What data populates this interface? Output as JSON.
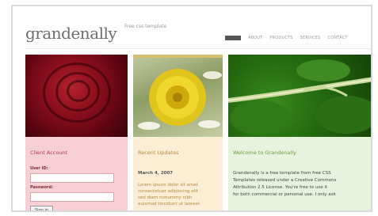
{
  "site": {
    "logo": "grandenally",
    "tagline": "Free css template"
  },
  "nav": {
    "items": [
      {
        "label": "Home",
        "active": true
      },
      {
        "label": "About",
        "active": false
      },
      {
        "label": "Products",
        "active": false
      },
      {
        "label": "Services",
        "active": false
      },
      {
        "label": "Contact",
        "active": false
      }
    ]
  },
  "login": {
    "title": "Client Account",
    "username_label": "User ID:",
    "password_label": "Password:",
    "button_label": "Sign in",
    "username_value": "",
    "password_value": ""
  },
  "news": {
    "title": "Recent Updates",
    "date": "March 4, 2007",
    "lines": [
      "Lorem ipsum dolor sit amet",
      "consectetuer adipiscing elit",
      "sed diam nonummy nibh",
      "euismod tincidunt ut laoreet"
    ]
  },
  "welcome": {
    "title": "Welcome to Grandenally",
    "lines": [
      "Grandenally is a free template from free CSS",
      "Templates released under a Creative Commons",
      "Attribution 2.5 License. You're free to use it",
      "for both commercial or personal use. I only ask"
    ]
  },
  "colors": {
    "login_panel": "#f7d0d5",
    "news_panel": "#fbeed4",
    "welcome_panel": "#e7f3dc",
    "login_title": "#b4304b",
    "news_title": "#b7873a",
    "welcome_title": "#6a9a3a"
  }
}
